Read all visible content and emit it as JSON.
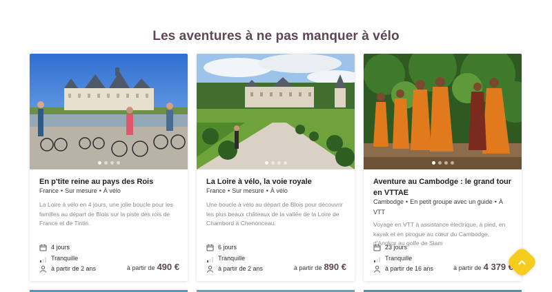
{
  "section": {
    "title": "Les aventures à ne pas manquer à vélo"
  },
  "cards": [
    {
      "title": "En p'tite reine au pays des Rois",
      "tags": [
        "France",
        "Sur mesure",
        "À vélo"
      ],
      "description": "La Loire à vélo en 4 jours, une jolie boucle pour les familles au départ de Blois sur la piste des rois de France et de Tintin.",
      "duration": "4 jours",
      "level": "Tranquille",
      "age": "à partir de 2 ans",
      "price_prefix": "à partir de",
      "price": "490 €"
    },
    {
      "title": "La Loire à vélo, la voie royale",
      "tags": [
        "France",
        "Sur mesure",
        "À vélo"
      ],
      "description": "Une boucle à vélo au départ de Blois pour découvrir les plus beaux châteaux de la vallée de la Loire de Chambord à Chenonceau.",
      "duration": "6 jours",
      "level": "Tranquille",
      "age": "à partir de 2 ans",
      "price_prefix": "à partir de",
      "price": "890 €"
    },
    {
      "title": "Aventure au Cambodge : le grand tour en VTTAE",
      "tags": [
        "Cambodge",
        "En petit groupe avec un guide",
        "À VTT"
      ],
      "description": "Voyage en VTT à assistance électrique, à pied, en kayak et en pirogue au cœur du Cambodge, d'Angkor au golfe de Siam",
      "duration": "23 jours",
      "level": "Tranquille",
      "age": "à partir de 16 ans",
      "price_prefix": "à partir de",
      "price": "4 379 €"
    }
  ],
  "icons": {
    "calendar": "calendar-icon",
    "level": "difficulty-bars-icon",
    "person": "person-icon",
    "scroll_top": "chevron-up-icon"
  },
  "colors": {
    "title": "#5e4656",
    "price": "#5e4656",
    "scroll_button": "#f6cd1c"
  }
}
